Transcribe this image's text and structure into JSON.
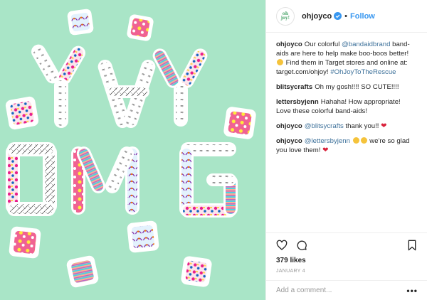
{
  "post": {
    "username": "ohjoyco",
    "follow_label": "Follow",
    "dot": "•",
    "avatar_text_line1": "oh",
    "avatar_text_line2": "joy!",
    "caption": {
      "user": "ohjoyco",
      "t1": "Our colorful ",
      "mention": "@bandaidbrand",
      "t2": " band-aids are here to help make boo-boos better! ",
      "t3": " Find them in Target stores and online at: target.com/ohjoy! ",
      "hashtag": "#OhJoyToTheRescue"
    },
    "comments": [
      {
        "user": "blitsycrafts",
        "text": "Oh my gosh!!!! SO CUTE!!!!"
      },
      {
        "user": "lettersbyjenn",
        "text": "Hahaha! How appropriate! Love these colorful band-aids!"
      }
    ],
    "reply1": {
      "user": "ohjoyco",
      "mention": "@blitsycrafts",
      "text": " thank you!! "
    },
    "reply2": {
      "user": "ohjoyco",
      "mention": "@lettersbyjenn",
      "text": " we're so glad you love them! "
    },
    "likes": "379 likes",
    "date": "JANUARY 4",
    "add_comment_placeholder": "Add a comment...",
    "more": "•••"
  },
  "colors": {
    "photo_bg": "#a9e5c7",
    "follow": "#3897f0",
    "link": "#3f729b",
    "verified": "#3897f0"
  },
  "icons": [
    "heart-icon",
    "comment-icon",
    "bookmark-icon",
    "verified-icon",
    "more-icon"
  ]
}
